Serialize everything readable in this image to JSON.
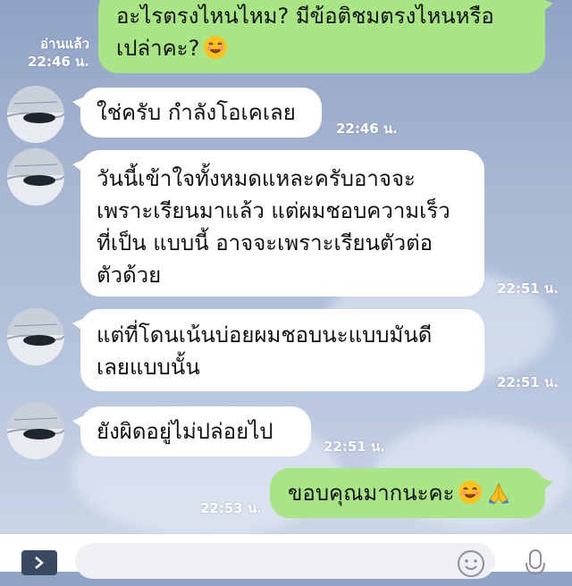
{
  "header": {
    "read_status": "อ่านแล้ว",
    "read_time": "22:46 น."
  },
  "messages": [
    {
      "sender": "me",
      "lines": [
        "อะไรตรงไหนไหม? มีข้อติชมตรงไหนหรือ",
        "เปล่าคะ?"
      ],
      "emoji": [
        "smiling-face-icon"
      ]
    },
    {
      "sender": "contact",
      "lines": [
        "ใช่ครับ กำลังโอเคเลย"
      ],
      "time": "22:46 น."
    },
    {
      "sender": "contact",
      "lines": [
        "วันนี้เข้าใจทั้งหมดแหละครับอาจจะ",
        "เพราะเรียนมาแล้ว แต่ผมชอบความเร็ว",
        "ที่เป็น แบบนี้ อาจจะเพราะเรียนตัวต่อ",
        "ตัวด้วย"
      ],
      "time": "22:51 น."
    },
    {
      "sender": "contact",
      "lines": [
        "แต่ที่โดนเน้นบ่อยผมชอบนะแบบมันดี",
        "เลยแบบนั้น"
      ],
      "time": "22:51 น."
    },
    {
      "sender": "contact",
      "lines": [
        "ยังผิดอยู่ไม่ปล่อยไป"
      ],
      "time": "22:51 น."
    },
    {
      "sender": "me",
      "lines": [
        "ขอบคุณมากนะคะ"
      ],
      "time": "22:53 น.",
      "emoji": [
        "smiling-face-icon",
        "folded-hands-icon"
      ]
    }
  ],
  "composer": {
    "placeholder": "",
    "icons": [
      "chevron-right-icon",
      "emoji-icon",
      "microphone-icon"
    ]
  },
  "colors": {
    "outgoing_bubble": "#a7e585",
    "incoming_bubble": "#ffffff",
    "background": "#a6b6d1"
  }
}
